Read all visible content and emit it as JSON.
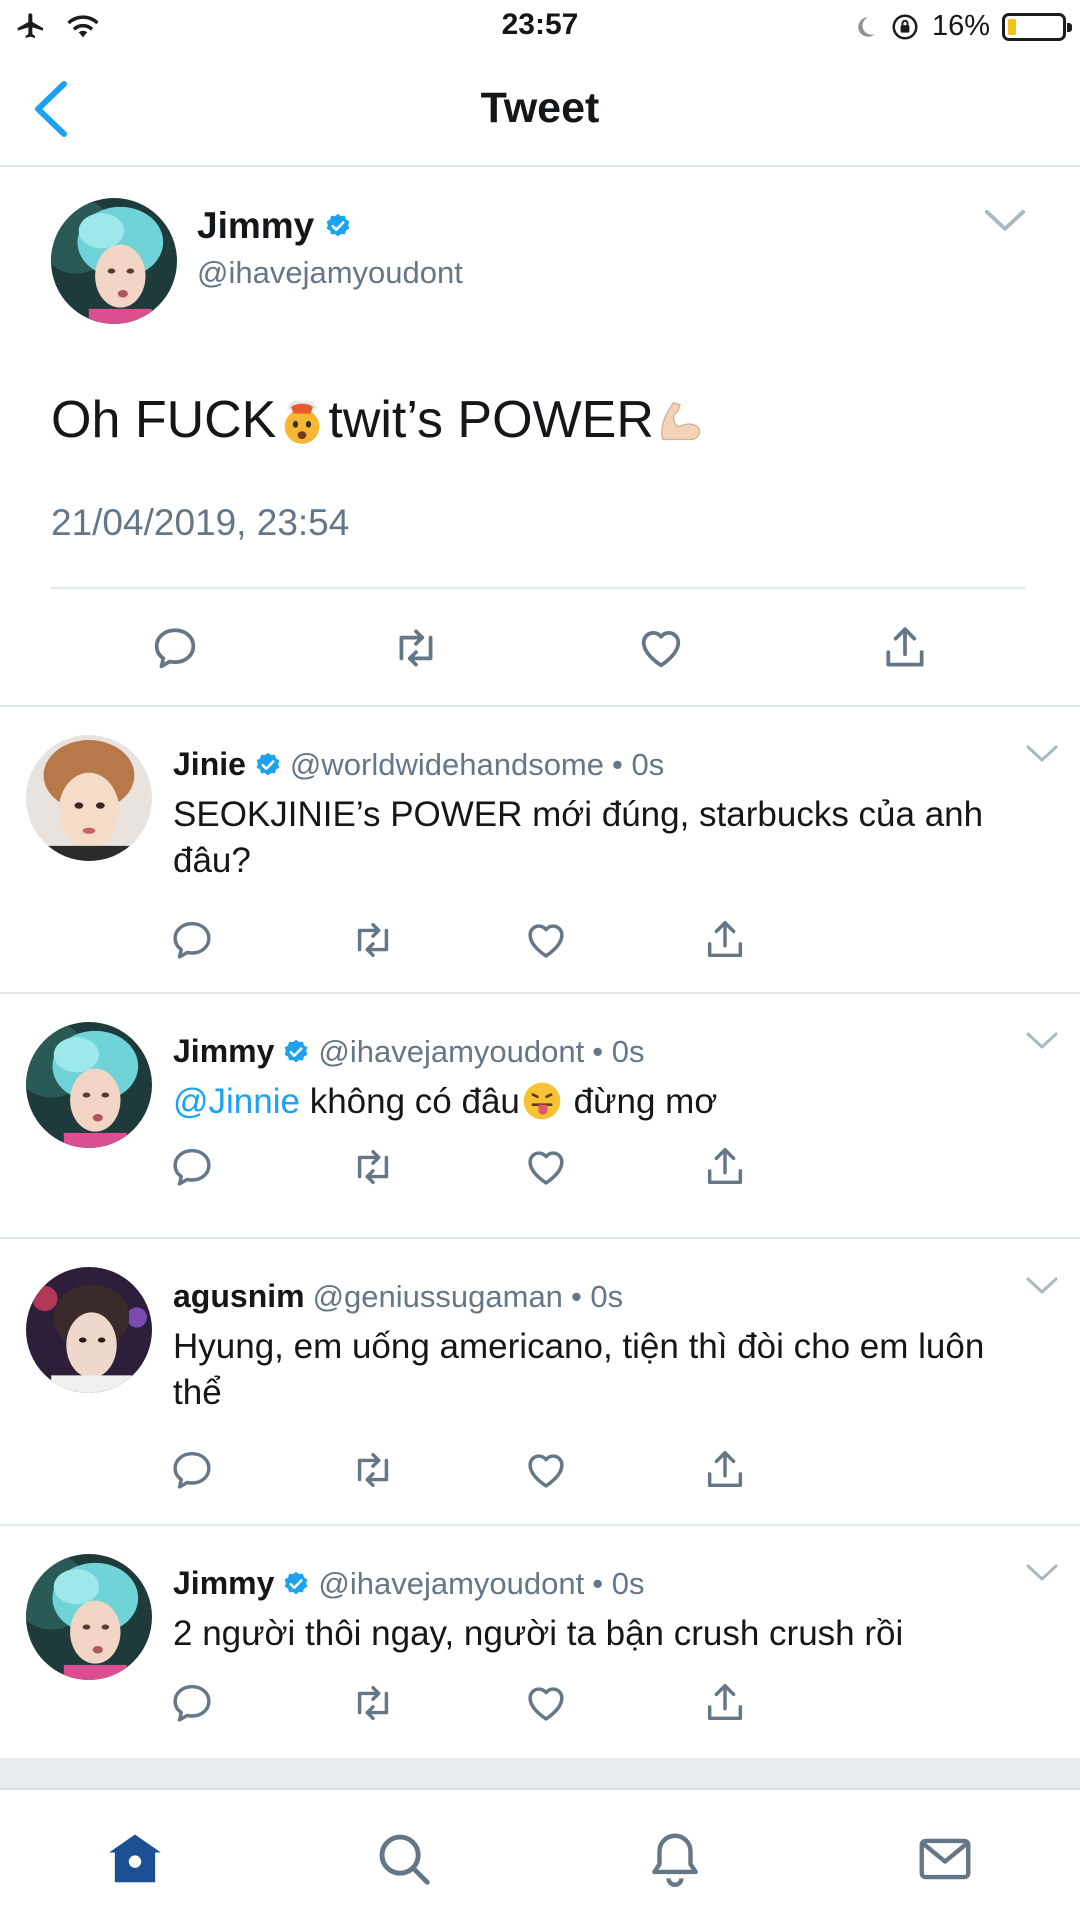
{
  "status_bar": {
    "time": "23:57",
    "battery_percent": "16%",
    "battery_level": 0.16,
    "icons": [
      "airplane-icon",
      "wifi-icon",
      "moon-icon",
      "orientation-lock-icon",
      "battery-icon"
    ]
  },
  "nav": {
    "title": "Tweet",
    "back_icon": "chevron-left-icon"
  },
  "main_tweet": {
    "name": "Jimmy",
    "handle": "@ihavejamyoudont",
    "text_part1": "Oh FUCK",
    "text_part2": " twit’s POWER",
    "timestamp": "21/04/2019, 23:54"
  },
  "replies": [
    {
      "name": "Jinie",
      "handle": "@worldwidehandsome",
      "time": "• 0s",
      "text": "SEOKJINIE’s POWER mới đúng, starbucks của anh đâu?"
    },
    {
      "name": "Jimmy",
      "handle": "@ihavejamyoudont",
      "time": "• 0s",
      "mention": "@Jinnie",
      "text_part1": " không có đâu",
      "text_part2": " đừng mơ"
    },
    {
      "name": "agusnim",
      "handle": "@geniussugaman",
      "time": "• 0s",
      "text": "Hyung, em uống americano, tiện thì đòi cho em luôn thể"
    },
    {
      "name": "Jimmy",
      "handle": "@ihavejamyoudont",
      "time": "• 0s",
      "text": "2 người thôi ngay, người ta bận crush crush rồi"
    }
  ],
  "tab_bar": {
    "tabs": [
      "home-icon",
      "search-icon",
      "notifications-icon",
      "messages-icon"
    ],
    "active": "home-icon"
  },
  "colors": {
    "accent": "#1da1f2",
    "verified": "#1da1f2",
    "secondary_text": "#657786",
    "divider": "#e1e8ed",
    "tab_active": "#1c4f94",
    "tab_inactive": "#657786"
  }
}
